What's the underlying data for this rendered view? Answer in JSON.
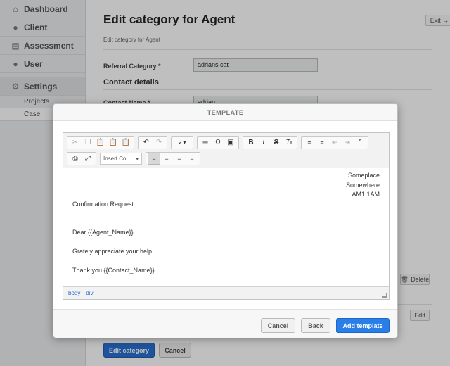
{
  "sidebar": {
    "items": [
      {
        "label": "Dashboard",
        "icon": "home-icon"
      },
      {
        "label": "Client",
        "icon": "person-icon"
      },
      {
        "label": "Assessment",
        "icon": "clipboard-icon"
      },
      {
        "label": "User",
        "icon": "person-icon"
      },
      {
        "label": "Settings",
        "icon": "gear-icon"
      }
    ],
    "sub_items": [
      {
        "label": "Projects"
      },
      {
        "label": "Case"
      }
    ]
  },
  "page": {
    "title": "Edit category for Agent",
    "subtitle": "Edit category for Agent",
    "exit_label": "Exit →",
    "referral_label": "Referral Category *",
    "referral_value": "adrians cat",
    "contact_section": "Contact details",
    "contact_name_label": "Contact Name *",
    "contact_name_value": "adrian",
    "delete_label": "Delete",
    "edit_label": "Edit",
    "edit_category_label": "Edit category",
    "cancel_label": "Cancel"
  },
  "modal": {
    "title": "TEMPLATE",
    "toolbar": {
      "combo_label": "Insert Co..."
    },
    "content": {
      "address_lines": [
        "Someplace",
        "Somewhere",
        "AM1 1AM"
      ],
      "heading": "Confirmation Request",
      "greeting": "Dear {{Agent_Name}}",
      "body": "Grately appreciate your help....",
      "closing": "Thank you {{Contact_Name}}"
    },
    "status_path": [
      "body",
      "div"
    ],
    "buttons": {
      "cancel": "Cancel",
      "back": "Back",
      "add": "Add template"
    }
  },
  "colors": {
    "primary": "#2a7ee8",
    "sidebar_bg": "#eceeef"
  }
}
